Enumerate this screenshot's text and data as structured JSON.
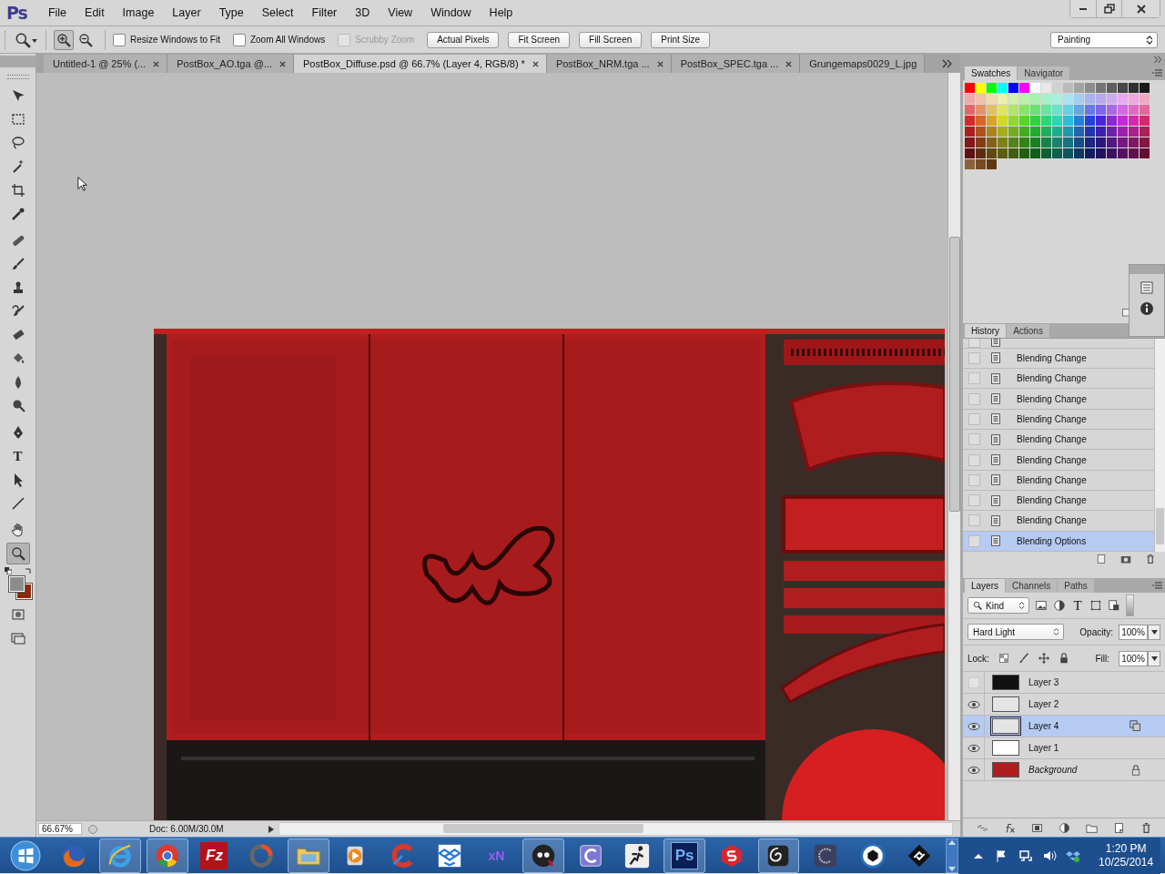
{
  "app": {
    "logo": "Ps"
  },
  "menu": [
    "File",
    "Edit",
    "Image",
    "Layer",
    "Type",
    "Select",
    "Filter",
    "3D",
    "View",
    "Window",
    "Help"
  ],
  "options_bar": {
    "zoom_modes": [
      {
        "kind": "zoom-in",
        "selected": true
      },
      {
        "kind": "zoom-out",
        "selected": false
      }
    ],
    "checkboxes": [
      {
        "label": "Resize Windows to Fit",
        "checked": false,
        "disabled": false
      },
      {
        "label": "Zoom All Windows",
        "checked": false,
        "disabled": false
      },
      {
        "label": "Scrubby Zoom",
        "checked": false,
        "disabled": true
      }
    ],
    "buttons": [
      "Actual Pixels",
      "Fit Screen",
      "Fill Screen",
      "Print Size"
    ],
    "workspace": "Painting"
  },
  "tabs": [
    {
      "label": "Untitled-1 @ 25% (...",
      "selected": false
    },
    {
      "label": "PostBox_AO.tga @...",
      "selected": false
    },
    {
      "label": "PostBox_Diffuse.psd @ 66.7% (Layer 4, RGB/8) *",
      "selected": true
    },
    {
      "label": "PostBox_NRM.tga ...",
      "selected": false
    },
    {
      "label": "PostBox_SPEC.tga ...",
      "selected": false
    },
    {
      "label": "Grungemaps0029_L.jpg",
      "selected": false,
      "closable": false
    }
  ],
  "tools": [
    {
      "kind": "move",
      "selected": false
    },
    {
      "kind": "marquee",
      "selected": false
    },
    {
      "kind": "lasso",
      "selected": false
    },
    {
      "kind": "magic-wand",
      "selected": false
    },
    {
      "kind": "crop",
      "selected": false
    },
    {
      "kind": "eyedropper",
      "selected": false
    },
    {
      "kind": "healing-brush",
      "selected": false
    },
    {
      "kind": "brush",
      "selected": false
    },
    {
      "kind": "stamp",
      "selected": false
    },
    {
      "kind": "history-brush",
      "selected": false
    },
    {
      "kind": "eraser",
      "selected": false
    },
    {
      "kind": "paint-bucket",
      "selected": false
    },
    {
      "kind": "blur",
      "selected": false
    },
    {
      "kind": "dodge",
      "selected": false
    },
    {
      "kind": "pen",
      "selected": false
    },
    {
      "kind": "type",
      "glyph": "T",
      "selected": false
    },
    {
      "kind": "path-selection",
      "selected": false
    },
    {
      "kind": "line",
      "selected": false
    },
    {
      "kind": "hand",
      "selected": false
    },
    {
      "kind": "zoom",
      "selected": true
    }
  ],
  "color_chips": [
    {
      "kind": "foreground",
      "color": "#8c8c8c"
    },
    {
      "kind": "background",
      "color": "#8a2a0a"
    }
  ],
  "status_bar": {
    "zoom": "66.67%",
    "doc": "Doc: 6.00M/30.0M"
  },
  "swatches_panel": {
    "tabs": [
      {
        "label": "Swatches",
        "selected": true
      },
      {
        "label": "Navigator",
        "selected": false
      }
    ]
  },
  "history_panel": {
    "tabs": [
      {
        "label": "History",
        "selected": true
      },
      {
        "label": "Actions",
        "selected": false
      }
    ],
    "items": [
      {
        "label": "Blending Change",
        "selected": false
      },
      {
        "label": "Blending Change",
        "selected": false
      },
      {
        "label": "Blending Change",
        "selected": false
      },
      {
        "label": "Blending Change",
        "selected": false
      },
      {
        "label": "Blending Change",
        "selected": false
      },
      {
        "label": "Blending Change",
        "selected": false
      },
      {
        "label": "Blending Change",
        "selected": false
      },
      {
        "label": "Blending Change",
        "selected": false
      },
      {
        "label": "Blending Change",
        "selected": false
      },
      {
        "label": "Blending Options",
        "selected": true
      }
    ]
  },
  "layers_panel": {
    "tabs": [
      {
        "label": "Layers",
        "selected": true
      },
      {
        "label": "Channels",
        "selected": false
      },
      {
        "label": "Paths",
        "selected": false
      }
    ],
    "filter": "Kind",
    "type_filter_glyph": "T",
    "blend_mode": "Hard Light",
    "opacity_label": "Opacity:",
    "opacity": "100%",
    "lock_label": "Lock:",
    "fill_label": "Fill:",
    "fill": "100%",
    "layers": [
      {
        "name": "Layer 3",
        "kind": "layer",
        "color": "#111111",
        "visible": false,
        "selected": false,
        "linked": false
      },
      {
        "name": "Layer 2",
        "kind": "layer",
        "color": "#e4e4e4",
        "visible": true,
        "selected": false,
        "linked": false
      },
      {
        "name": "Layer 4",
        "kind": "layer",
        "color": "#e4e4e4",
        "visible": true,
        "selected": true,
        "linked": true
      },
      {
        "name": "Layer 1",
        "kind": "layer",
        "color": "#ffffff",
        "visible": true,
        "selected": false,
        "linked": false
      },
      {
        "name": "Background",
        "kind": "background",
        "color": "#b01d1e",
        "visible": true,
        "selected": false,
        "linked": false
      }
    ]
  },
  "taskbar": {
    "apps": [
      {
        "kind": "fox-globe",
        "running": false
      },
      {
        "kind": "e-ring",
        "running": true
      },
      {
        "kind": "wheel",
        "running": true
      },
      {
        "kind": "text-tile",
        "text": "Fz",
        "running": false
      },
      {
        "kind": "arc-ring",
        "running": false
      },
      {
        "kind": "folder",
        "running": true
      },
      {
        "kind": "play",
        "running": false
      },
      {
        "kind": "c-brush",
        "running": false
      },
      {
        "kind": "open-box",
        "running": false
      },
      {
        "kind": "text-plain",
        "text": "xN",
        "running": false
      },
      {
        "kind": "mascot-head",
        "running": true
      },
      {
        "kind": "c-square",
        "running": false
      },
      {
        "kind": "running-figure",
        "running": false
      },
      {
        "kind": "text-tile-ps",
        "text": "Ps",
        "running": true
      },
      {
        "kind": "s-hex",
        "running": false
      },
      {
        "kind": "spiral",
        "running": true
      },
      {
        "kind": "c-circle",
        "running": false
      },
      {
        "kind": "aperture",
        "running": false
      },
      {
        "kind": "diamond-mark",
        "running": false
      }
    ],
    "time": "1:20 PM",
    "date": "10/25/2014"
  }
}
